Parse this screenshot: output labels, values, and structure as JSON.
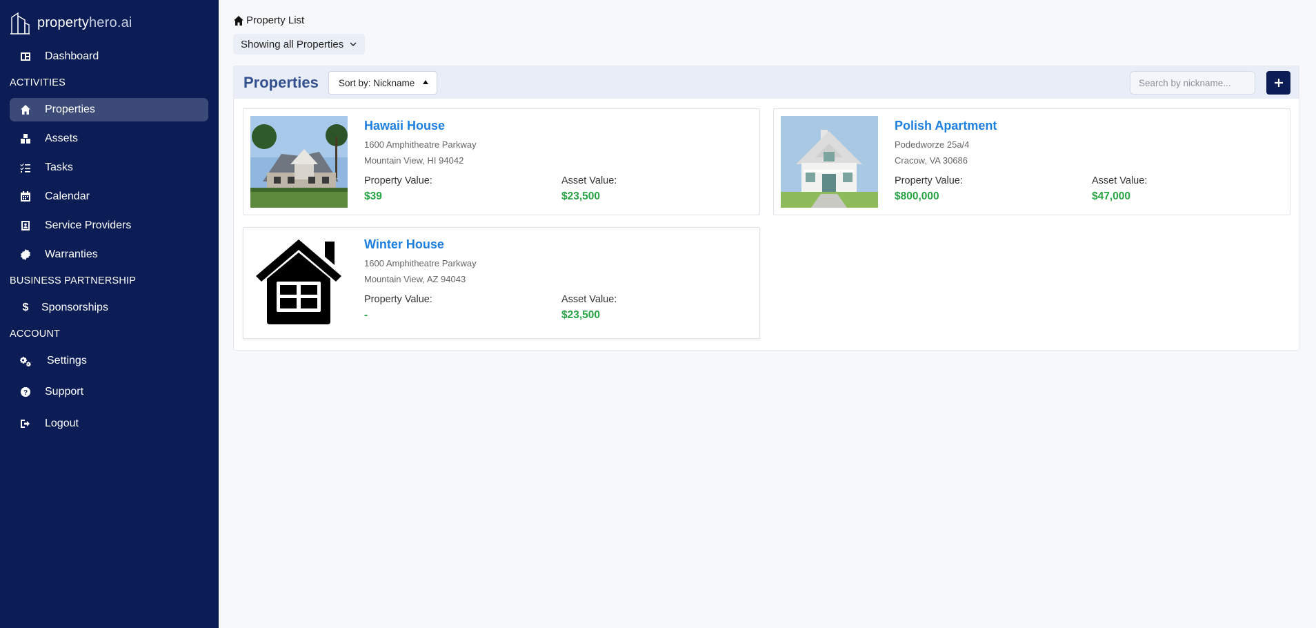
{
  "app": {
    "logo_bold": "property",
    "logo_light": "hero.ai"
  },
  "sidebar": {
    "dashboard": "Dashboard",
    "section_activities": "ACTIVITIES",
    "properties": "Properties",
    "assets": "Assets",
    "tasks": "Tasks",
    "calendar": "Calendar",
    "service_providers": "Service Providers",
    "warranties": "Warranties",
    "section_business": "BUSINESS PARTNERSHIP",
    "sponsorships": "Sponsorships",
    "section_account": "ACCOUNT",
    "settings": "Settings",
    "support": "Support",
    "logout": "Logout",
    "active_color": "#3c4a78",
    "bg_color": "#0c1c54"
  },
  "header": {
    "breadcrumb": "Property List",
    "filter_label": "Showing all Properties"
  },
  "panel": {
    "title": "Properties",
    "sort_label": "Sort by: Nickname",
    "search_placeholder": "Search by nickname..."
  },
  "properties": [
    {
      "name": "Hawaii House",
      "address1": "1600 Amphitheatre Parkway",
      "address2": "Mountain View, HI 94042",
      "property_value_label": "Property Value:",
      "property_value": "$39",
      "asset_value_label": "Asset Value:",
      "asset_value": "$23,500"
    },
    {
      "name": "Polish Apartment",
      "address1": "Podedworze 25a/4",
      "address2": "Cracow, VA 30686",
      "property_value_label": "Property Value:",
      "property_value": "$800,000",
      "asset_value_label": "Asset Value:",
      "asset_value": "$47,000"
    },
    {
      "name": "Winter House",
      "address1": "1600 Amphitheatre Parkway",
      "address2": "Mountain View, AZ 94043",
      "property_value_label": "Property Value:",
      "property_value": "-",
      "asset_value_label": "Asset Value:",
      "asset_value": "$23,500"
    }
  ]
}
